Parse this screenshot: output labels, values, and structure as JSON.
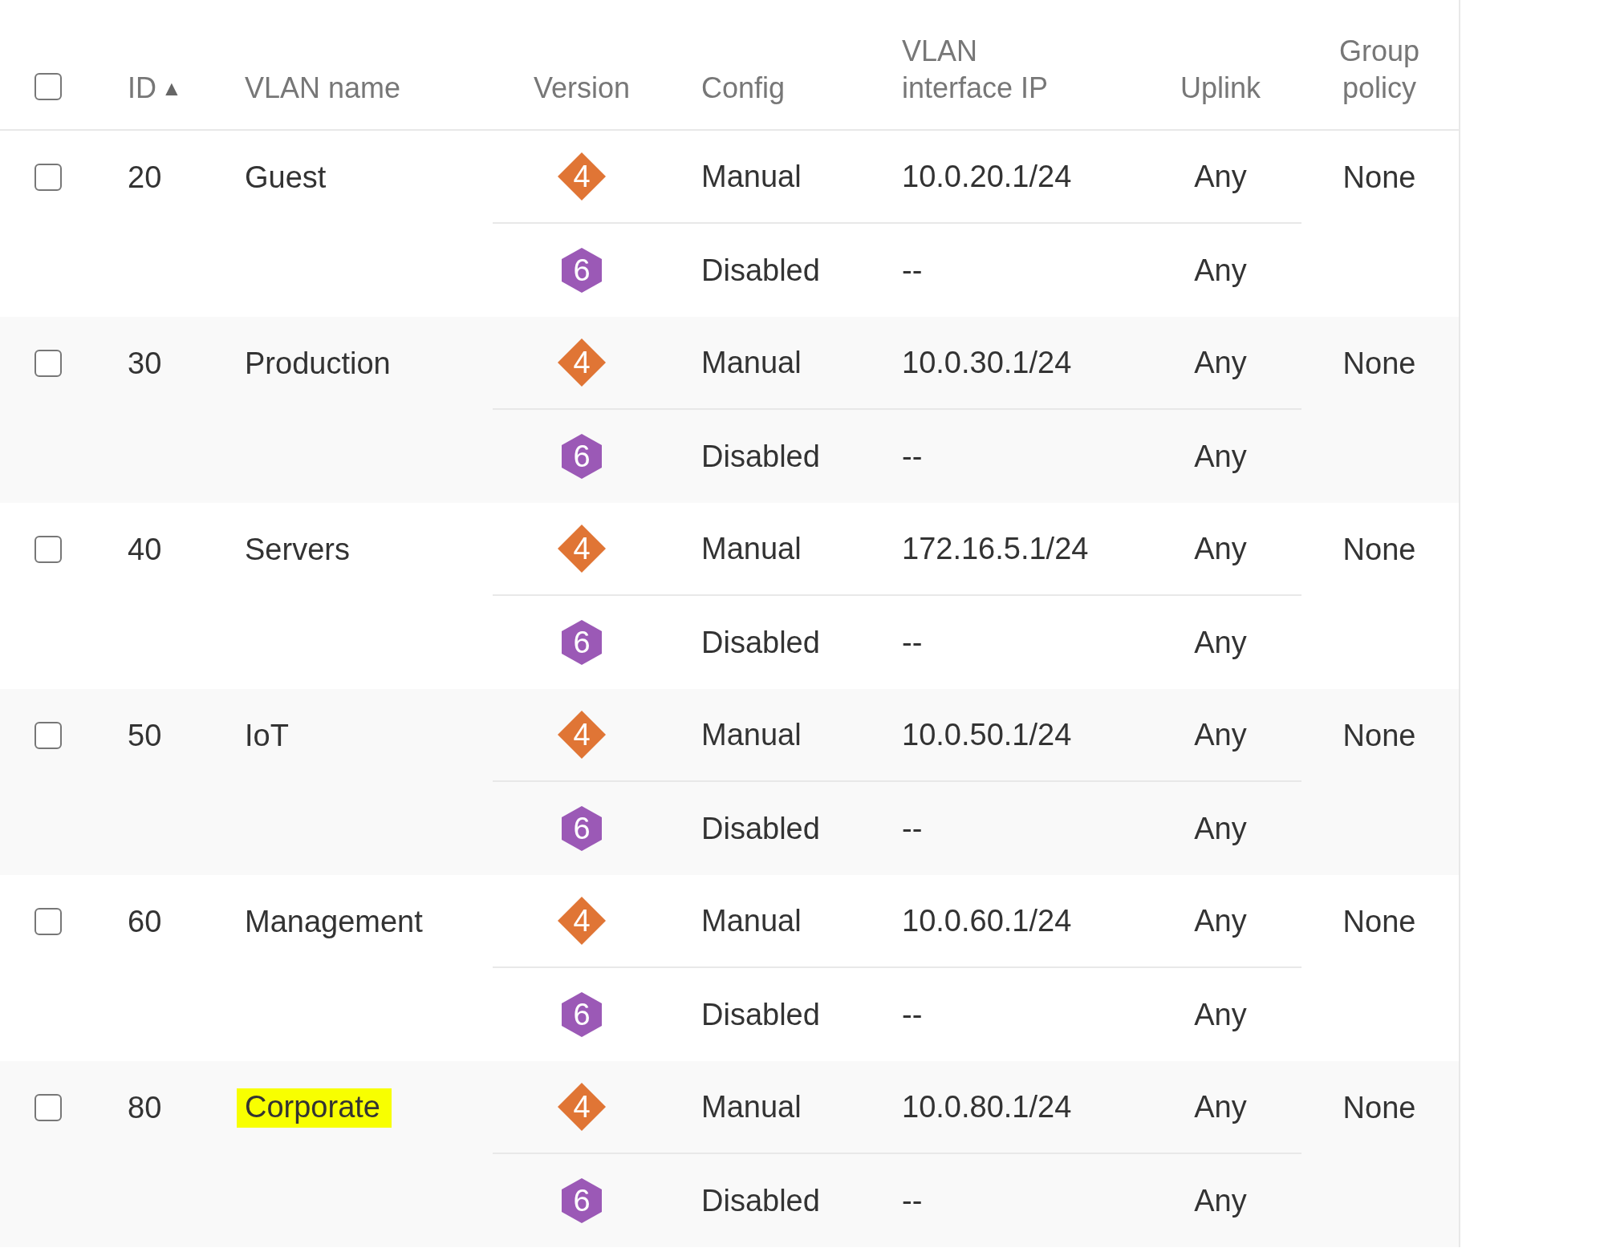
{
  "table": {
    "select_all": {
      "checked": false
    },
    "columns": [
      {
        "label": "ID",
        "sort": "▲"
      },
      {
        "label": "VLAN name"
      },
      {
        "label": "Version"
      },
      {
        "label": "Config"
      },
      {
        "label": "VLAN interface IP"
      },
      {
        "label": "Uplink"
      },
      {
        "label": "Group policy"
      }
    ],
    "rows": [
      {
        "checked": false,
        "id": "20",
        "name": "Guest",
        "highlighted": false,
        "group_policy": "None",
        "versions": [
          {
            "kind": "diamond",
            "badge": "4",
            "config": "Manual",
            "ip": "10.0.20.1/24",
            "uplink": "Any"
          },
          {
            "kind": "hexagon",
            "badge": "6",
            "config": "Disabled",
            "ip": "--",
            "uplink": "Any"
          }
        ]
      },
      {
        "checked": false,
        "id": "30",
        "name": "Production",
        "highlighted": false,
        "group_policy": "None",
        "versions": [
          {
            "kind": "diamond",
            "badge": "4",
            "config": "Manual",
            "ip": "10.0.30.1/24",
            "uplink": "Any"
          },
          {
            "kind": "hexagon",
            "badge": "6",
            "config": "Disabled",
            "ip": "--",
            "uplink": "Any"
          }
        ]
      },
      {
        "checked": false,
        "id": "40",
        "name": "Servers",
        "highlighted": false,
        "group_policy": "None",
        "versions": [
          {
            "kind": "diamond",
            "badge": "4",
            "config": "Manual",
            "ip": "172.16.5.1/24",
            "uplink": "Any"
          },
          {
            "kind": "hexagon",
            "badge": "6",
            "config": "Disabled",
            "ip": "--",
            "uplink": "Any"
          }
        ]
      },
      {
        "checked": false,
        "id": "50",
        "name": "IoT",
        "highlighted": false,
        "group_policy": "None",
        "versions": [
          {
            "kind": "diamond",
            "badge": "4",
            "config": "Manual",
            "ip": "10.0.50.1/24",
            "uplink": "Any"
          },
          {
            "kind": "hexagon",
            "badge": "6",
            "config": "Disabled",
            "ip": "--",
            "uplink": "Any"
          }
        ]
      },
      {
        "checked": false,
        "id": "60",
        "name": "Management",
        "highlighted": false,
        "group_policy": "None",
        "versions": [
          {
            "kind": "diamond",
            "badge": "4",
            "config": "Manual",
            "ip": "10.0.60.1/24",
            "uplink": "Any"
          },
          {
            "kind": "hexagon",
            "badge": "6",
            "config": "Disabled",
            "ip": "--",
            "uplink": "Any"
          }
        ]
      },
      {
        "checked": false,
        "id": "80",
        "name": "Corporate",
        "highlighted": true,
        "group_policy": "None",
        "versions": [
          {
            "kind": "diamond",
            "badge": "4",
            "config": "Manual",
            "ip": "10.0.80.1/24",
            "uplink": "Any"
          },
          {
            "kind": "hexagon",
            "badge": "6",
            "config": "Disabled",
            "ip": "--",
            "uplink": "Any"
          }
        ]
      }
    ]
  }
}
